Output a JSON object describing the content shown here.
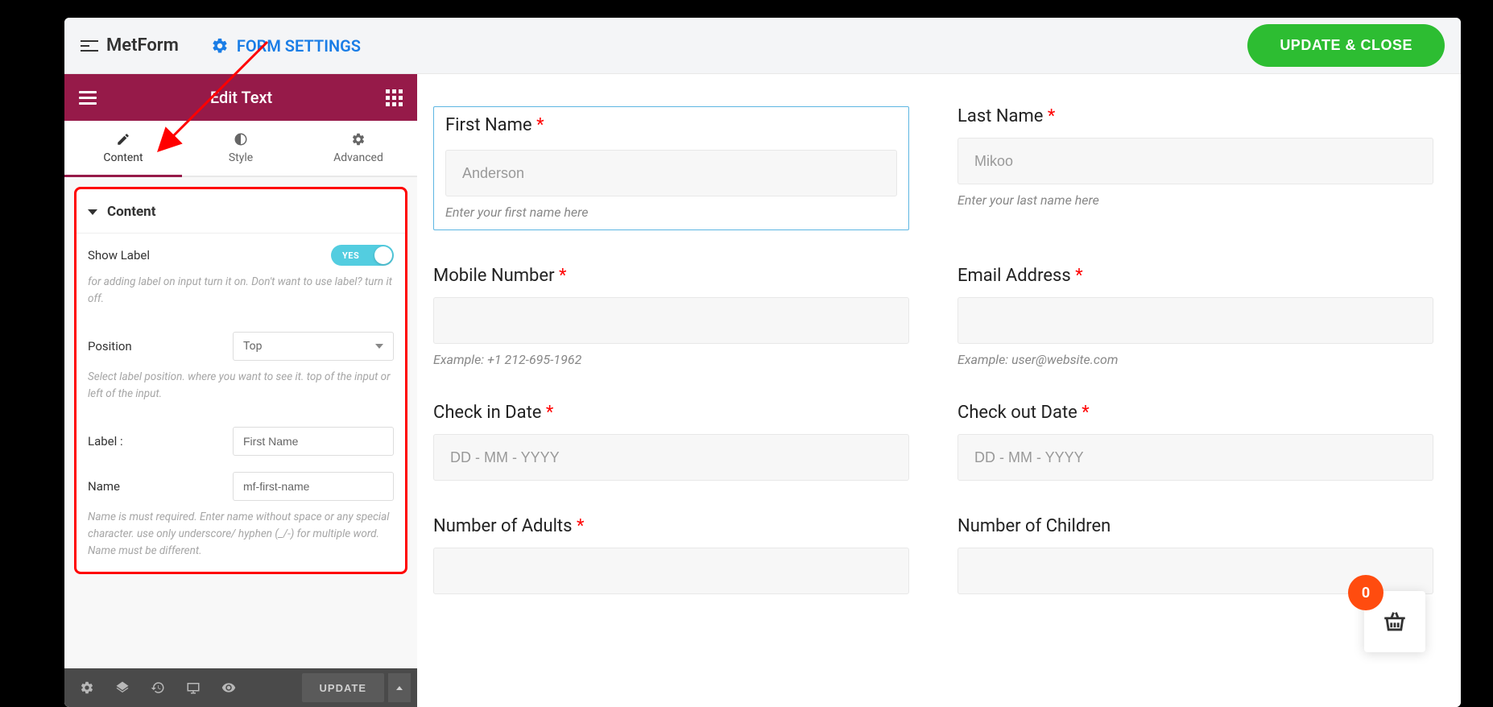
{
  "header": {
    "app_title": "MetForm",
    "form_settings_label": "FORM SETTINGS",
    "update_close_label": "UPDATE & CLOSE"
  },
  "sidebar_header": {
    "title": "Edit Text"
  },
  "tabs": {
    "content": "Content",
    "style": "Style",
    "advanced": "Advanced"
  },
  "panel": {
    "section_title": "Content",
    "show_label": {
      "label": "Show Label",
      "switch_text": "YES",
      "help": "for adding label on input turn it on. Don't want to use label? turn it off."
    },
    "position": {
      "label": "Position",
      "value": "Top",
      "help": "Select label position. where you want to see it. top of the input or left of the input."
    },
    "label_field": {
      "label": "Label :",
      "value": "First Name"
    },
    "name_field": {
      "label": "Name",
      "value": "mf-first-name",
      "help": "Name is must required. Enter name without space or any special character. use only underscore/ hyphen (_/-) for multiple word. Name must be different."
    }
  },
  "bottom_toolbar": {
    "update_label": "UPDATE"
  },
  "collapse_handle": {
    "glyph": "‹"
  },
  "preview": {
    "fields": {
      "first_name": {
        "label": "First Name",
        "placeholder": "Anderson",
        "hint": "Enter your first name here"
      },
      "last_name": {
        "label": "Last Name",
        "placeholder": "Mikoo",
        "hint": "Enter your last name here"
      },
      "mobile": {
        "label": "Mobile Number",
        "hint": "Example: +1 212-695-1962"
      },
      "email": {
        "label": "Email Address",
        "hint": "Example: user@website.com"
      },
      "check_in": {
        "label": "Check in Date",
        "placeholder": "DD - MM - YYYY"
      },
      "check_out": {
        "label": "Check out Date",
        "placeholder": "DD - MM - YYYY"
      },
      "adults": {
        "label": "Number of Adults"
      },
      "children": {
        "label": "Number of Children"
      }
    }
  },
  "cart": {
    "count": "0"
  },
  "req_star": "*"
}
